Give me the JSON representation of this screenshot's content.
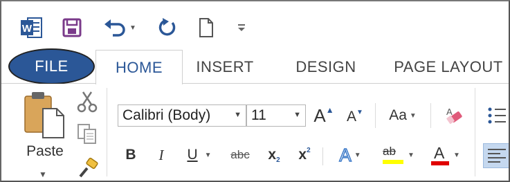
{
  "quick_access": {
    "icons": [
      "word-icon",
      "save-icon",
      "undo-icon",
      "redo-icon",
      "new-document-icon",
      "customize-qat-icon"
    ],
    "colors": {
      "word": "#2b5797",
      "save": "#7a3a8a",
      "accent": "#2b5797"
    }
  },
  "tabs": [
    {
      "label": "FILE"
    },
    {
      "label": "HOME"
    },
    {
      "label": "INSERT"
    },
    {
      "label": "DESIGN"
    },
    {
      "label": "PAGE LAYOUT"
    }
  ],
  "clipboard": {
    "paste_label": "Paste",
    "icons": [
      "paste-icon",
      "cut-icon",
      "copy-icon",
      "format-painter-icon"
    ]
  },
  "font": {
    "font_name": "Calibri (Body)",
    "font_size": "11",
    "grow_label": "A",
    "shrink_label": "A",
    "change_case_label": "Aa",
    "bold_label": "B",
    "italic_label": "I",
    "underline_label": "U",
    "strike_label": "abc",
    "subscript_label": "x",
    "subscript_suffix": "2",
    "superscript_label": "x",
    "superscript_suffix": "2",
    "text_effects_label": "A",
    "highlight_label": "ab",
    "font_color_label": "A",
    "colors": {
      "highlight": "#ffff00",
      "font_color": "#e00000",
      "effects": "#3a78c8",
      "eraser": "#e05a7a"
    }
  }
}
